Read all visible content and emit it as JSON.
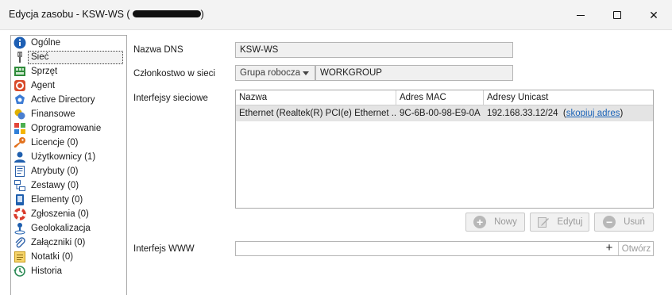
{
  "window": {
    "title": "Edycja zasobu - KSW-WS (",
    "title_suffix": ")"
  },
  "nav": {
    "items": [
      {
        "label": "Ogólne",
        "icon": "info-icon"
      },
      {
        "label": "Sieć",
        "icon": "network-plug-icon",
        "selected": true
      },
      {
        "label": "Sprzęt",
        "icon": "hardware-icon"
      },
      {
        "label": "Agent",
        "icon": "agent-icon"
      },
      {
        "label": "Active Directory",
        "icon": "active-directory-icon"
      },
      {
        "label": "Finansowe",
        "icon": "finance-icon"
      },
      {
        "label": "Oprogramowanie",
        "icon": "software-icon"
      },
      {
        "label": "Licencje (0)",
        "icon": "key-icon"
      },
      {
        "label": "Użytkownicy (1)",
        "icon": "user-icon"
      },
      {
        "label": "Atrybuty (0)",
        "icon": "attributes-icon"
      },
      {
        "label": "Zestawy (0)",
        "icon": "sets-icon"
      },
      {
        "label": "Elementy (0)",
        "icon": "elements-icon"
      },
      {
        "label": "Zgłoszenia (0)",
        "icon": "lifebuoy-icon"
      },
      {
        "label": "Geolokalizacja",
        "icon": "geolocation-icon"
      },
      {
        "label": "Załączniki (0)",
        "icon": "attachment-icon"
      },
      {
        "label": "Notatki (0)",
        "icon": "notes-icon"
      },
      {
        "label": "Historia",
        "icon": "history-icon"
      }
    ]
  },
  "form": {
    "dns_label": "Nazwa DNS",
    "dns_value": "KSW-WS",
    "membership_label": "Członkostwo w sieci",
    "membership_type": "Grupa robocza",
    "membership_value": "WORKGROUP",
    "interfaces_label": "Interfejsy sieciowe",
    "www_label": "Interfejs WWW",
    "www_value": "",
    "www_open_label": "Otwórz"
  },
  "interfaces_table": {
    "columns": [
      "Nazwa",
      "Adres MAC",
      "Adresy Unicast"
    ],
    "rows": [
      {
        "name": "Ethernet (Realtek(R) PCI(e) Ethernet ...",
        "mac": "9C-6B-00-98-E9-0A",
        "unicast": "192.168.33.12/24",
        "copy_open": "(",
        "copy_link": "skopiuj adres",
        "copy_close": ")"
      }
    ]
  },
  "buttons": {
    "new": "Nowy",
    "edit": "Edytuj",
    "delete": "Usuń"
  }
}
